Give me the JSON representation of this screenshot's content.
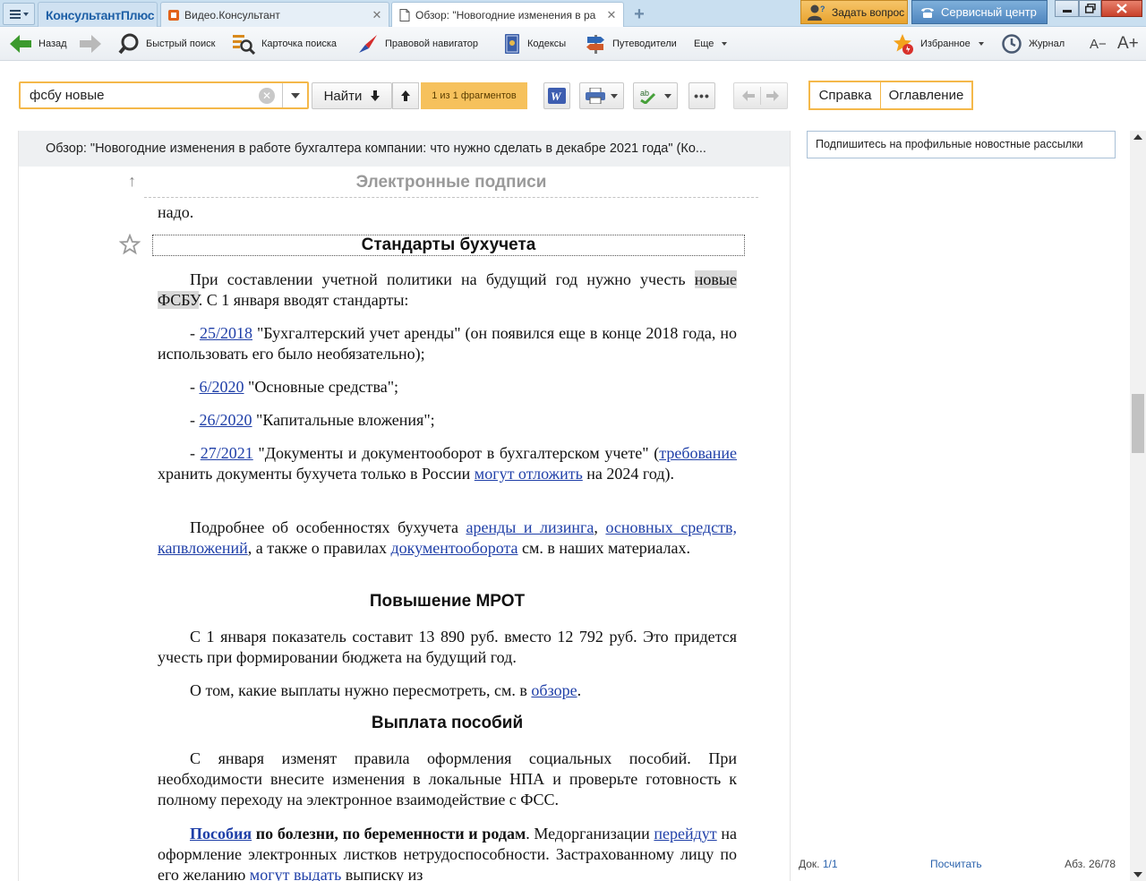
{
  "colors": {
    "accent_orange": "#f4b84a",
    "tabbar_blue": "#c9dff0",
    "link_blue": "#1f3fa8",
    "highlight_gray": "#d9d9d9",
    "status_link": "#2b63ad"
  },
  "tabs": [
    {
      "label": "КонсультантПлюс",
      "icon": "brand-logo"
    },
    {
      "label": "Видео.Консультант",
      "icon": "video-icon"
    },
    {
      "label": "Обзор: \"Новогодние изменения в ра",
      "icon": "document-icon"
    }
  ],
  "titlebar": {
    "ask_label": "Задать вопрос",
    "service_label": "Сервисный центр"
  },
  "toolbar": {
    "back": "Назад",
    "quick_search": "Быстрый поиск",
    "search_card": "Карточка поиска",
    "legal_navigator": "Правовой навигатор",
    "codexes": "Кодексы",
    "guides": "Путеводители",
    "more": "Еще",
    "favorites": "Избранное",
    "journal": "Журнал",
    "font_decrease": "A−",
    "font_increase": "A+"
  },
  "search": {
    "value": "фсбу новые",
    "find_label": "Найти",
    "fragments": "1 из 1 фрагментов"
  },
  "side_tabs": {
    "help": "Справка",
    "toc": "Оглавление"
  },
  "document": {
    "header": "Обзор: \"Новогодние изменения в работе бухгалтера компании: что нужно сделать в декабре 2021 года\" (Ко...",
    "section_electronic": "Электронные подписи",
    "tail_text": "надо.",
    "section_standards": "Стандарты бухучета",
    "p1": {
      "a": "При составлении учетной политики на будущий год нужно учесть ",
      "hl1": "новые",
      "b": " ",
      "hl2": "ФСБУ",
      "c": ". С 1 января вводят стандарты:"
    },
    "item1": {
      "dash": "- ",
      "link": "25/2018",
      "text": " \"Бухгалтерский учет аренды\" (он появился еще в конце 2018 года, но использовать его было необязательно);"
    },
    "item2": {
      "dash": "- ",
      "link": "6/2020",
      "text": " \"Основные средства\";"
    },
    "item3": {
      "dash": "- ",
      "link": "26/2020",
      "text": " \"Капитальные вложения\";"
    },
    "item4": {
      "dash": "- ",
      "link": "27/2021",
      "a": " \"Документы и документооборот в бухгалтерском учете\" (",
      "link2": "требование",
      "b": " хранить документы бухучета только в России ",
      "link3": "могут отложить",
      "c": " на 2024 год)."
    },
    "p2": {
      "a": "Подробнее об особенностях бухучета ",
      "link1": "аренды и лизинга",
      "b": ", ",
      "link2": "основных средств, капвложений",
      "c": ", а также о правилах ",
      "link3": "документооборота",
      "d": " см. в наших материалах."
    },
    "section_mrot": "Повышение МРОТ",
    "p3": "С 1 января показатель составит 13 890 руб. вместо 12 792 руб. Это придется учесть при формировании бюджета на будущий год.",
    "p4": {
      "a": "О том, какие выплаты нужно пересмотреть, см. в ",
      "link": "обзоре",
      "b": "."
    },
    "section_benefits": "Выплата пособий",
    "p5": "С января изменят правила оформления социальных пособий. При необходимости внесите изменения в локальные НПА и проверьте готовность к полному переходу на электронное взаимодействие с ФСС.",
    "p6": {
      "link1": "Пособия",
      "bold": " по болезни, по беременности и родам",
      "a": ". Медорганизации ",
      "link2": "перейдут",
      "b": " на оформление электронных листков нетрудоспособности. Застрахованному лицу по его желанию ",
      "link3": "могут",
      "c": " ",
      "link4": "выдать",
      "d": " выписку из"
    }
  },
  "right_panel": {
    "subscribe": "Подпишитесь на профильные новостные рассылки",
    "status_doc_label": "Док.",
    "status_doc_value": "1/1",
    "status_count": "Посчитать",
    "status_par_label": "Абз.",
    "status_par_value": "26/78"
  }
}
